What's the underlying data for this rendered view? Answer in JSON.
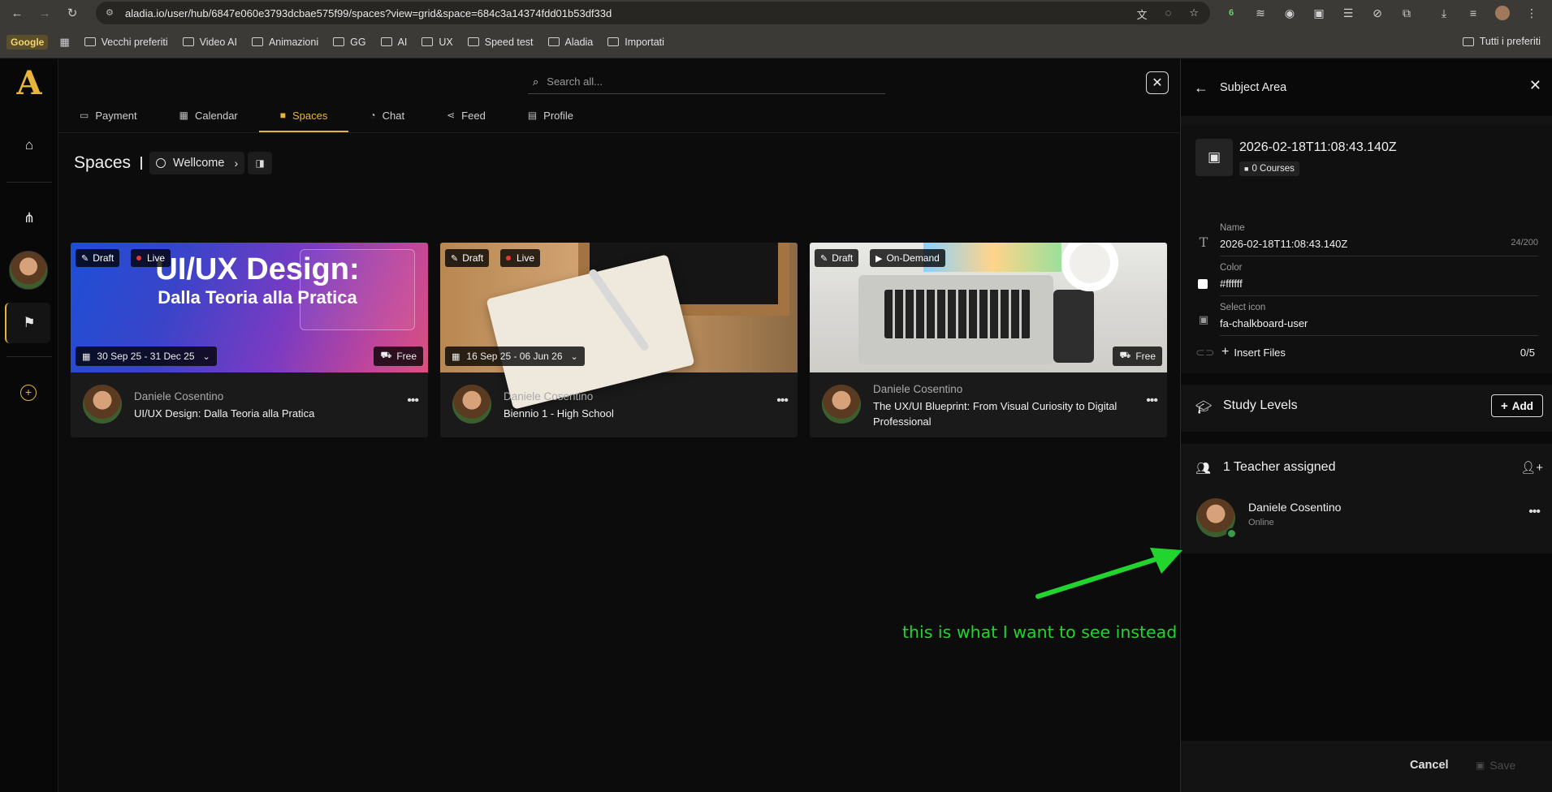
{
  "browser": {
    "url": "aladia.io/user/hub/6847e060e3793dcbae575f99/spaces?view=grid&space=684c3a14374fdd01b53df33d",
    "bookmarks": [
      "Vecchi preferiti",
      "Video AI",
      "Animazioni",
      "GG",
      "AI",
      "UX",
      "Speed test",
      "Aladia",
      "Importati"
    ],
    "google_label": "Google",
    "all_bookmarks_label": "Tutti i preferiti",
    "extension_badge": "6"
  },
  "app": {
    "logo": "A",
    "search": {
      "placeholder": "Search all..."
    },
    "tabs": [
      {
        "label": "Payment",
        "icon": "wallet-icon"
      },
      {
        "label": "Calendar",
        "icon": "calendar-icon"
      },
      {
        "label": "Spaces",
        "icon": "spaces-icon",
        "active": true
      },
      {
        "label": "Chat",
        "icon": "chat-icon"
      },
      {
        "label": "Feed",
        "icon": "share-icon"
      },
      {
        "label": "Profile",
        "icon": "id-card-icon"
      }
    ],
    "page_title": "Spaces",
    "breadcrumb": "Wellcome",
    "accent": "#e7b53b"
  },
  "cards": [
    {
      "badges": [
        "Draft",
        "Live"
      ],
      "image_title": "UI/UX Design:",
      "image_subtitle": "Dalla Teoria alla Pratica",
      "date": "30 Sep 25 - 31 Dec 25",
      "price": "Free",
      "author": "Daniele Cosentino",
      "title": "UI/UX Design: Dalla Teoria alla Pratica"
    },
    {
      "badges": [
        "Draft",
        "Live"
      ],
      "date": "16 Sep 25 - 06 Jun 26",
      "author": "Daniele Cosentino",
      "title": "Biennio 1 - High School"
    },
    {
      "badges": [
        "Draft",
        "On-Demand"
      ],
      "price": "Free",
      "author": "Daniele Cosentino",
      "title": "The UX/UI Blueprint: From Visual Curiosity to Digital Professional"
    }
  ],
  "panel": {
    "title": "Subject Area",
    "area_name": "2026-02-18T11:08:43.140Z",
    "courses": "0 Courses",
    "fields": {
      "name": {
        "label": "Name",
        "value": "2026-02-18T11:08:43.140Z",
        "counter": "24/200"
      },
      "color": {
        "label": "Color",
        "value": "#ffffff"
      },
      "icon": {
        "label": "Select icon",
        "value": "fa-chalkboard-user"
      }
    },
    "insert_files": "Insert Files",
    "files_count": "0/5",
    "study_levels": "Study Levels",
    "add_label": "Add",
    "teachers_header": "1 Teacher assigned",
    "teacher": {
      "name": "Daniele Cosentino",
      "status": "Online"
    },
    "cancel_label": "Cancel",
    "save_label": "Save"
  },
  "annotation": {
    "text": "this is what I want to see instead",
    "color": "#21d42e"
  }
}
